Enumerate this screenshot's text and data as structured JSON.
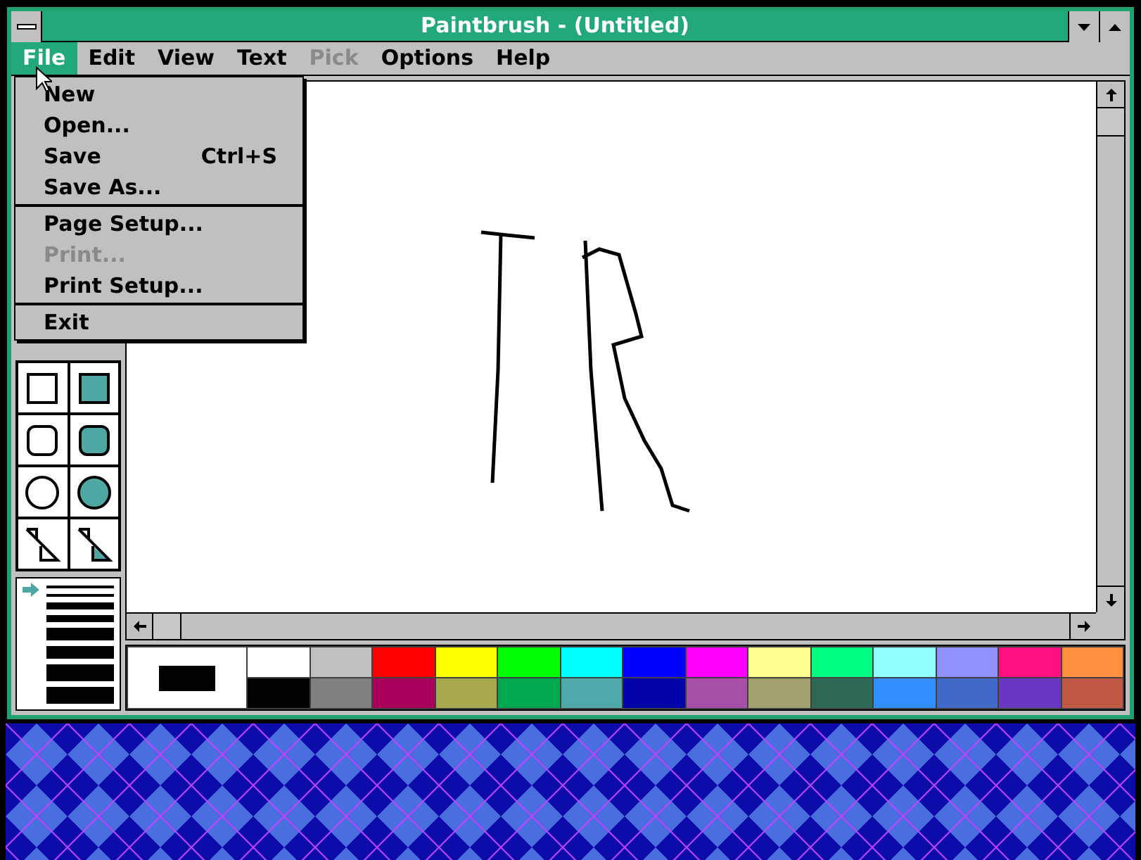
{
  "window": {
    "title": "Paintbrush - (Untitled)"
  },
  "menu_bar": [
    {
      "label": "File",
      "selected": true,
      "disabled": false
    },
    {
      "label": "Edit",
      "selected": false,
      "disabled": false
    },
    {
      "label": "View",
      "selected": false,
      "disabled": false
    },
    {
      "label": "Text",
      "selected": false,
      "disabled": false
    },
    {
      "label": "Pick",
      "selected": false,
      "disabled": true
    },
    {
      "label": "Options",
      "selected": false,
      "disabled": false
    },
    {
      "label": "Help",
      "selected": false,
      "disabled": false
    }
  ],
  "file_menu": [
    [
      {
        "label": "New",
        "disabled": false
      },
      {
        "label": "Open...",
        "disabled": false
      },
      {
        "label": "Save",
        "shortcut": "Ctrl+S",
        "disabled": false
      },
      {
        "label": "Save As...",
        "disabled": false
      }
    ],
    [
      {
        "label": "Page Setup...",
        "disabled": false
      },
      {
        "label": "Print...",
        "disabled": true
      },
      {
        "label": "Print Setup...",
        "disabled": false
      }
    ],
    [
      {
        "label": "Exit",
        "disabled": false
      }
    ]
  ],
  "tools": [
    {
      "kind": "rectangle",
      "filled": false
    },
    {
      "kind": "rectangle",
      "filled": true
    },
    {
      "kind": "rounded",
      "filled": false
    },
    {
      "kind": "rounded",
      "filled": true
    },
    {
      "kind": "ellipse",
      "filled": false
    },
    {
      "kind": "ellipse",
      "filled": true
    },
    {
      "kind": "polygon",
      "filled": false
    },
    {
      "kind": "polygon",
      "filled": true
    }
  ],
  "line_widths": [
    {
      "selected": true
    },
    {
      "selected": false
    },
    {
      "selected": false
    },
    {
      "selected": false
    },
    {
      "selected": false
    },
    {
      "selected": false
    },
    {
      "selected": false
    },
    {
      "selected": false
    }
  ],
  "current_foreground": {
    "color": "#000000"
  },
  "current_background": {
    "color": "#ffffff"
  },
  "palette_top": [
    {
      "color": "#ffffff"
    },
    {
      "color": "#c0c0c0"
    },
    {
      "color": "#ff0000"
    },
    {
      "color": "#ffff00"
    },
    {
      "color": "#00ff00"
    },
    {
      "color": "#00ffff"
    },
    {
      "color": "#0000ff"
    },
    {
      "color": "#ff00ff"
    },
    {
      "color": "#ffff90"
    },
    {
      "color": "#00ff80"
    },
    {
      "color": "#90ffff"
    },
    {
      "color": "#9090ff"
    },
    {
      "color": "#ff1080"
    },
    {
      "color": "#ff9040"
    }
  ],
  "palette_bottom": [
    {
      "color": "#000000"
    },
    {
      "color": "#808080"
    },
    {
      "color": "#a8005a"
    },
    {
      "color": "#a8a850"
    },
    {
      "color": "#00a850"
    },
    {
      "color": "#50a8a8"
    },
    {
      "color": "#0000a8"
    },
    {
      "color": "#a850a8"
    },
    {
      "color": "#a0a070"
    },
    {
      "color": "#306858"
    },
    {
      "color": "#3090ff"
    },
    {
      "color": "#4068c8"
    },
    {
      "color": "#6838c0"
    },
    {
      "color": "#c05848"
    }
  ]
}
